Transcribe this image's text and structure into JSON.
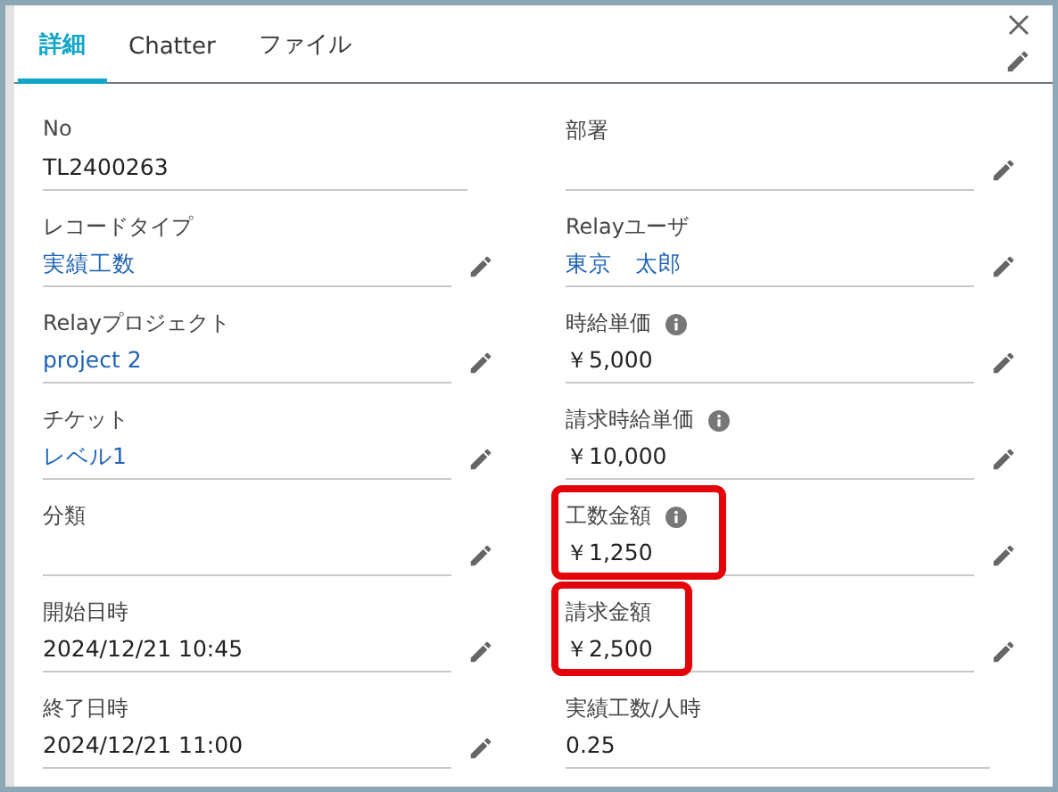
{
  "tabs": [
    {
      "label": "詳細",
      "selected": true
    },
    {
      "label": "Chatter",
      "selected": false
    },
    {
      "label": "ファイル",
      "selected": false
    }
  ],
  "fields": [
    {
      "label": "No",
      "value": "TL2400263",
      "kind": "text",
      "editable": false,
      "info": false,
      "highlighted": false
    },
    {
      "label": "部署",
      "editable": true,
      "info": false,
      "highlighted": false
    },
    {
      "label": "レコードタイプ",
      "value": "実績工数",
      "kind": "link",
      "editable": true,
      "info": false,
      "highlighted": false
    },
    {
      "label": "Relayユーザ",
      "value": "東京　太郎",
      "kind": "link",
      "editable": true,
      "info": false,
      "highlighted": false
    },
    {
      "label": "Relayプロジェクト",
      "value": "project 2",
      "kind": "link",
      "editable": true,
      "info": false,
      "highlighted": false
    },
    {
      "label": "時給単価",
      "value": "￥5,000",
      "kind": "text",
      "editable": true,
      "info": true,
      "highlighted": false
    },
    {
      "label": "チケット",
      "value": "レベル1",
      "kind": "link",
      "editable": true,
      "info": false,
      "highlighted": false
    },
    {
      "label": "請求時給単価",
      "value": "￥10,000",
      "kind": "text",
      "editable": true,
      "info": true,
      "highlighted": false
    },
    {
      "label": "分類",
      "editable": true,
      "info": false,
      "highlighted": false
    },
    {
      "label": "工数金額",
      "value": "￥1,250",
      "kind": "text",
      "editable": true,
      "info": true,
      "highlighted": true
    },
    {
      "label": "開始日時",
      "value": "2024/12/21 10:45",
      "kind": "text",
      "editable": true,
      "info": false,
      "highlighted": false
    },
    {
      "label": "請求金額",
      "value": "￥2,500",
      "kind": "text",
      "editable": true,
      "info": false,
      "highlighted": true
    },
    {
      "label": "終了日時",
      "value": "2024/12/21 11:00",
      "kind": "text",
      "editable": true,
      "info": false,
      "highlighted": false
    },
    {
      "label": "実績工数/人時",
      "value": "0.25",
      "kind": "text",
      "editable": false,
      "info": false,
      "highlighted": false
    }
  ]
}
